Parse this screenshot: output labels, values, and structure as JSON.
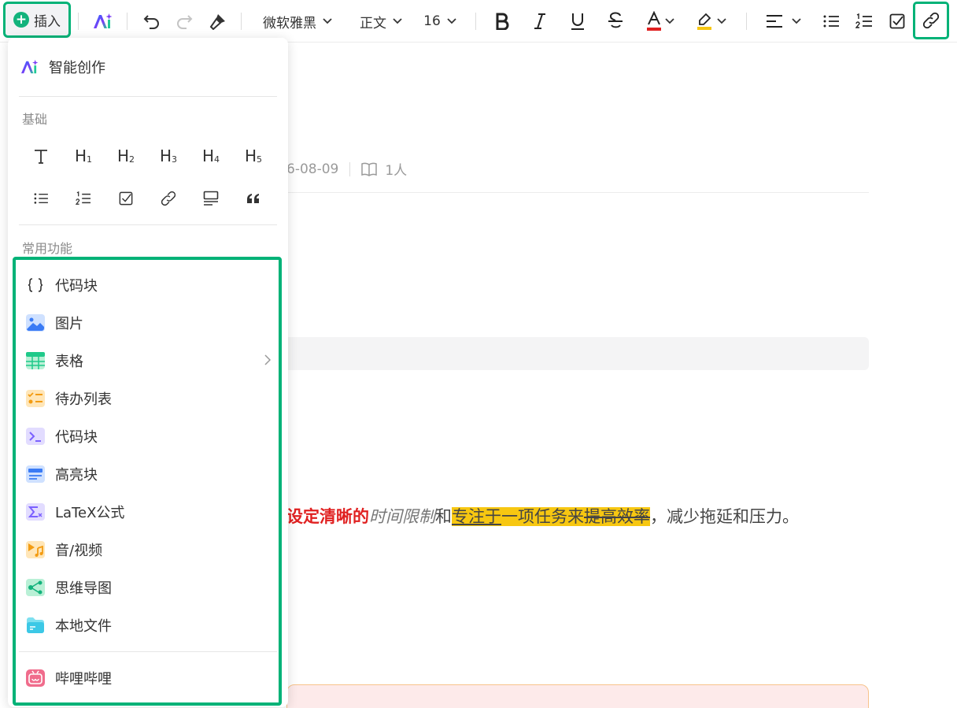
{
  "toolbar": {
    "insert_label": "插入",
    "font_family": "微软雅黑",
    "paragraph_style": "正文",
    "font_size": "16",
    "accent_color": "#00b277",
    "font_color": "#e02020",
    "highlight_color": "#f7c711"
  },
  "document": {
    "meta_date_fragment": "6-08-09",
    "meta_readers": "1人",
    "body_red": "设定清晰的",
    "body_italic": "时间限制",
    "body_and": "和",
    "body_underlined": "专注于",
    "body_highlight_plain": "一项任务来",
    "body_strike": "提高效率",
    "body_tail": "，减少拖延和压力。"
  },
  "menu": {
    "ai_label": "智能创作",
    "basic_title": "基础",
    "heading_letter": "H",
    "heading_levels": [
      "1",
      "2",
      "3",
      "4",
      "5"
    ],
    "common_title": "常用功能",
    "items": [
      {
        "label": "代码块",
        "icon": "curly-braces-icon"
      },
      {
        "label": "图片",
        "icon": "image-icon"
      },
      {
        "label": "表格",
        "icon": "table-icon"
      },
      {
        "label": "待办列表",
        "icon": "todo-list-icon"
      },
      {
        "label": "代码块",
        "icon": "terminal-icon"
      },
      {
        "label": "高亮块",
        "icon": "highlight-block-icon"
      },
      {
        "label": "LaTeX公式",
        "icon": "sigma-icon"
      },
      {
        "label": "音/视频",
        "icon": "media-icon"
      },
      {
        "label": "思维导图",
        "icon": "mind-map-icon"
      },
      {
        "label": "本地文件",
        "icon": "folder-icon"
      }
    ],
    "bilibili_label": "哔哩哔哩"
  }
}
